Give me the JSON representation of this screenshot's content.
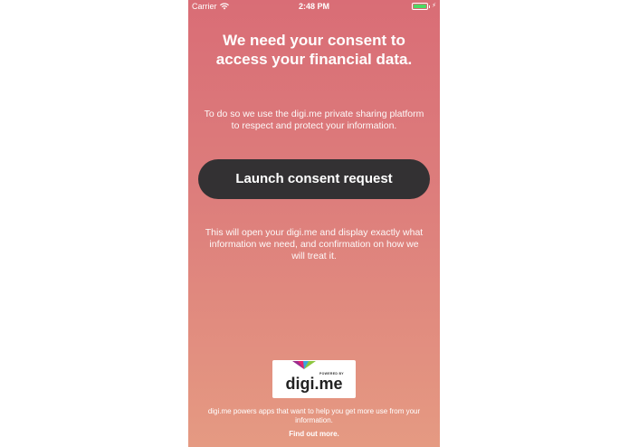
{
  "status_bar": {
    "carrier": "Carrier",
    "time": "2:48 PM",
    "battery_color": "#4cd964",
    "icons": [
      "wifi-icon",
      "battery-icon",
      "charging-bolt-icon"
    ]
  },
  "consent": {
    "headline": "We need your consent to access your financial data.",
    "subtext": "To do so we use the digi.me private sharing platform to respect and protect your information.",
    "button_label": "Launch consent request",
    "info_text": "This will open your digi.me and display exactly what information we need, and confirmation on how we will treat it."
  },
  "branding": {
    "powered_by": "POWERED BY",
    "wordmark": "digi.me",
    "footer_text": "digi.me powers apps that want to help you get more use from your information.",
    "link_label": "Find out more."
  },
  "colors": {
    "background_top": "#d96d76",
    "background_bottom": "#e59a82",
    "button": "#333133"
  }
}
